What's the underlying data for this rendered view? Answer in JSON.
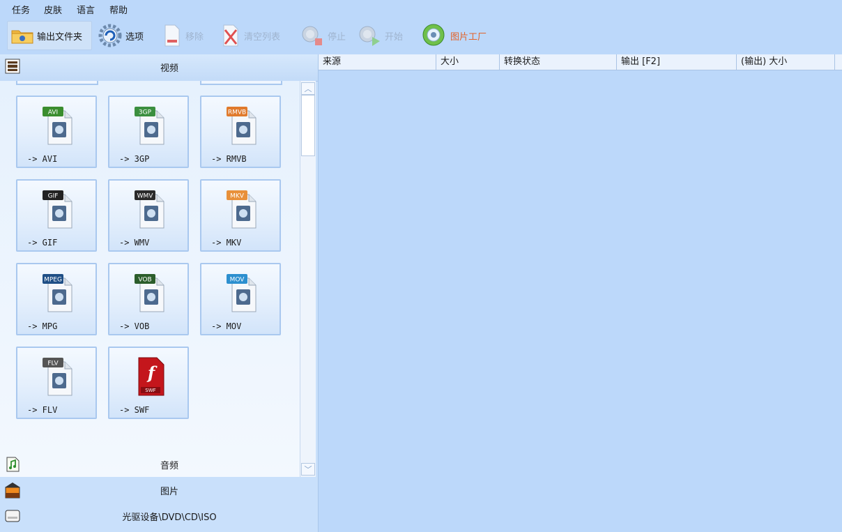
{
  "menu": [
    "任务",
    "皮肤",
    "语言",
    "帮助"
  ],
  "toolbar": {
    "output_folder": "输出文件夹",
    "options": "选项",
    "remove": "移除",
    "clear_list": "清空列表",
    "stop": "停止",
    "start": "开始",
    "picture_factory": "图片工厂"
  },
  "left_panel": {
    "categories": {
      "video": "视频",
      "audio": "音频",
      "image": "图片",
      "optical": "光驱设备\\DVD\\CD\\ISO"
    },
    "formats": [
      {
        "badge": "AVI",
        "label": "-> AVI",
        "color": "#3a8d2e"
      },
      {
        "badge": "3GP",
        "label": "-> 3GP",
        "color": "#3b8f3f"
      },
      {
        "badge": "RMVB",
        "label": "-> RMVB",
        "color": "#e07a2c"
      },
      {
        "badge": "GIF",
        "label": "-> GIF",
        "color": "#222222"
      },
      {
        "badge": "WMV",
        "label": "-> WMV",
        "color": "#2a2a2a"
      },
      {
        "badge": "MKV",
        "label": "-> MKV",
        "color": "#e8903a"
      },
      {
        "badge": "MPEG",
        "label": "-> MPG",
        "color": "#1f4f86"
      },
      {
        "badge": "VOB",
        "label": "-> VOB",
        "color": "#2b5d2b"
      },
      {
        "badge": "MOV",
        "label": "-> MOV",
        "color": "#2c8fcf"
      },
      {
        "badge": "FLV",
        "label": "-> FLV",
        "color": "#555555"
      },
      {
        "badge": "SWF",
        "label": "-> SWF",
        "color": "#c4161c"
      }
    ]
  },
  "table": {
    "columns": [
      "来源",
      "大小",
      "转换状态",
      "输出 [F2]",
      "(输出) 大小"
    ]
  },
  "colors": {
    "background": "#bcd8fa",
    "accent_orange": "#e2632a",
    "disabled": "#9fb4cf"
  }
}
